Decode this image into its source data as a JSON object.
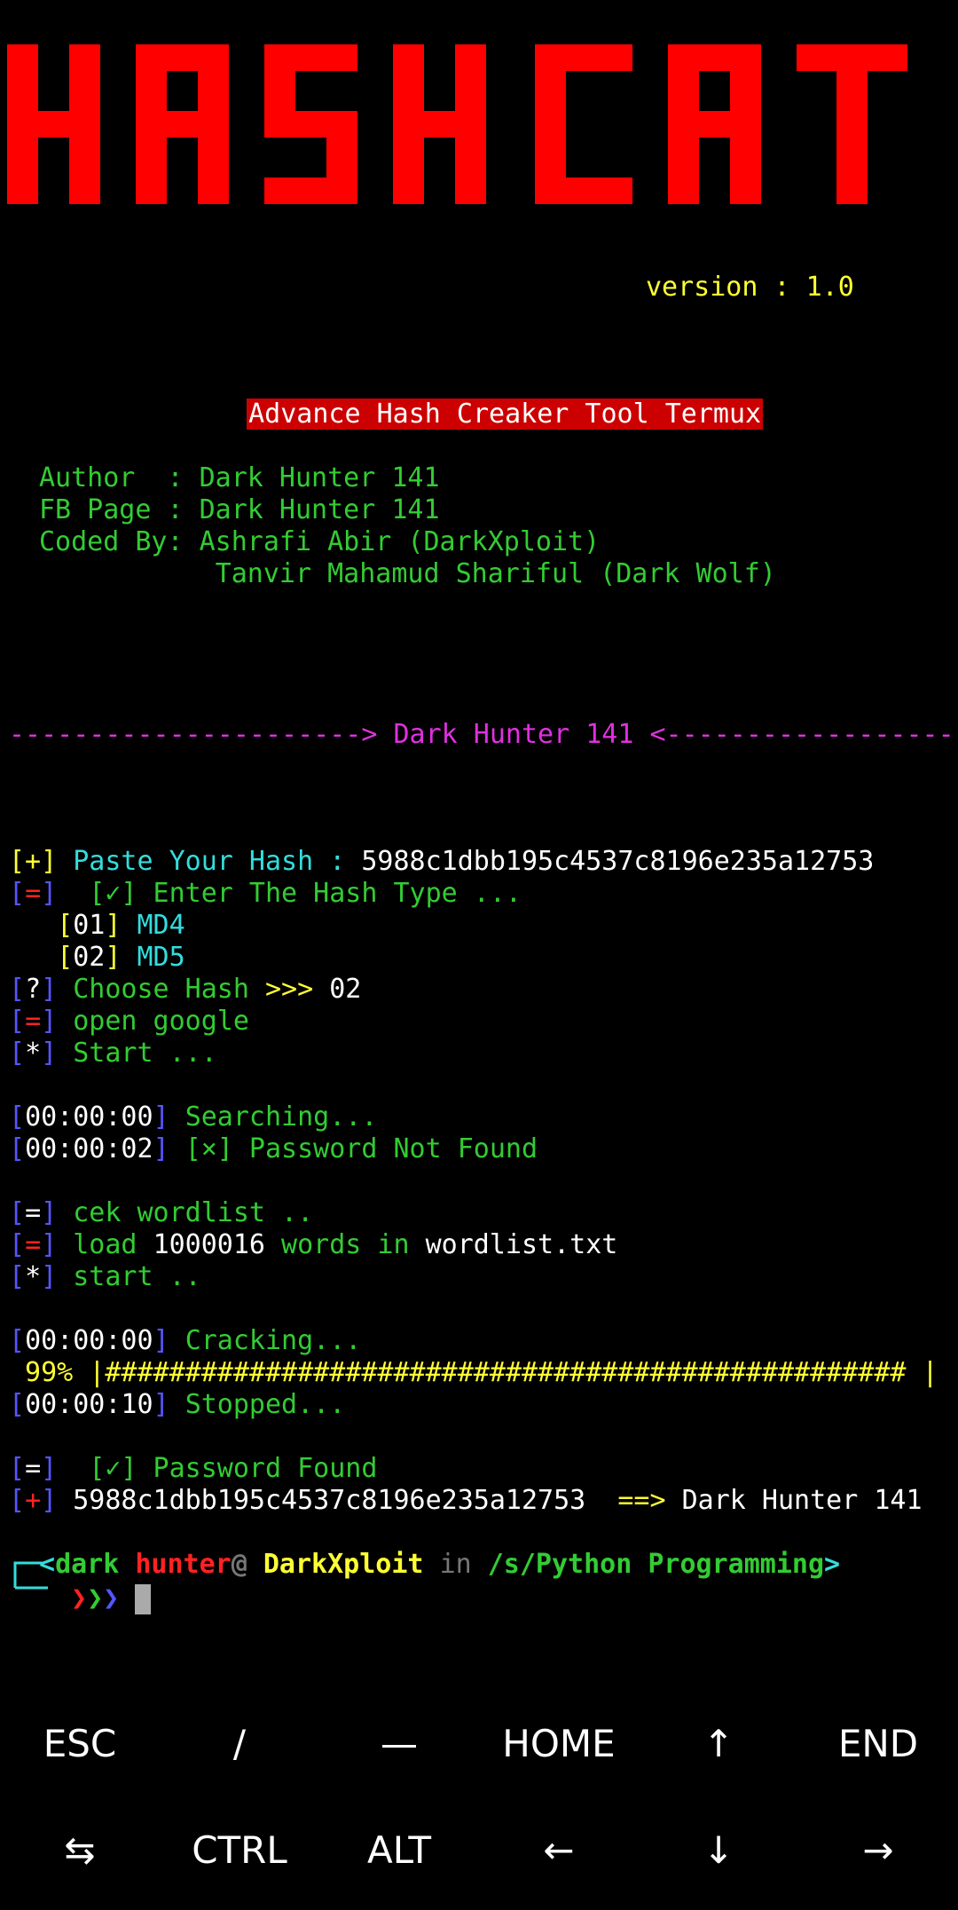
{
  "logo_text": "HASHCAT",
  "version": "version : 1.0",
  "subtitle": "Advance Hash Creaker Tool Termux",
  "credits": {
    "author_label": "Author  : ",
    "author": "Dark Hunter 141",
    "fb_label": "FB Page : ",
    "fb": "Dark Hunter 141",
    "coded_label": "Coded By: ",
    "coded1": "Ashrafi Abir (DarkXploit)",
    "coded2": "           Tanvir Mahamud Shariful (Dark Wolf)"
  },
  "divider": {
    "left": "----------------------> ",
    "text": "Dark Hunter 141",
    "right": " <------------------"
  },
  "session": {
    "paste_label": "Paste Your Hash : ",
    "hash": "5988c1dbb195c4537c8196e235a12753",
    "enter_type": "[✓] Enter The Hash Type ...",
    "opt1_num": "01",
    "opt1_name": "MD4",
    "opt2_num": "02",
    "opt2_name": "MD5",
    "choose_label": "Choose Hash >>> ",
    "choose_value": "02",
    "open_google": "open google",
    "start1": "Start ...",
    "t1": "00:00:00",
    "searching": "Searching...",
    "t2": "00:00:02",
    "not_found": "[×] Password Not Found",
    "cek": "cek wordlist ..",
    "load_a": "load ",
    "load_count": "1000016",
    "load_b": " words in ",
    "load_file": "wordlist.txt",
    "start2": "start ..",
    "t3": "00:00:00",
    "cracking": "Cracking...",
    "progress_pct": " 99% ",
    "progress_bar": "|################################################## |",
    "t4": "00:00:10",
    "stopped": "Stopped...",
    "found": "[✓] Password Found",
    "result_hash": "5988c1dbb195c4537c8196e235a12753",
    "arrow": "  ==> ",
    "result": "Dark Hunter 141"
  },
  "prompt": {
    "user1": "dark",
    "user2": "hunter",
    "at": "@",
    "host": "DarkXploit",
    "in": "in",
    "path": "/s/Python Programming"
  },
  "keys_row1": [
    "ESC",
    "/",
    "—",
    "HOME",
    "↑",
    "END"
  ],
  "keys_row2": [
    "⇆",
    "CTRL",
    "ALT",
    "←",
    "↓",
    "→"
  ]
}
